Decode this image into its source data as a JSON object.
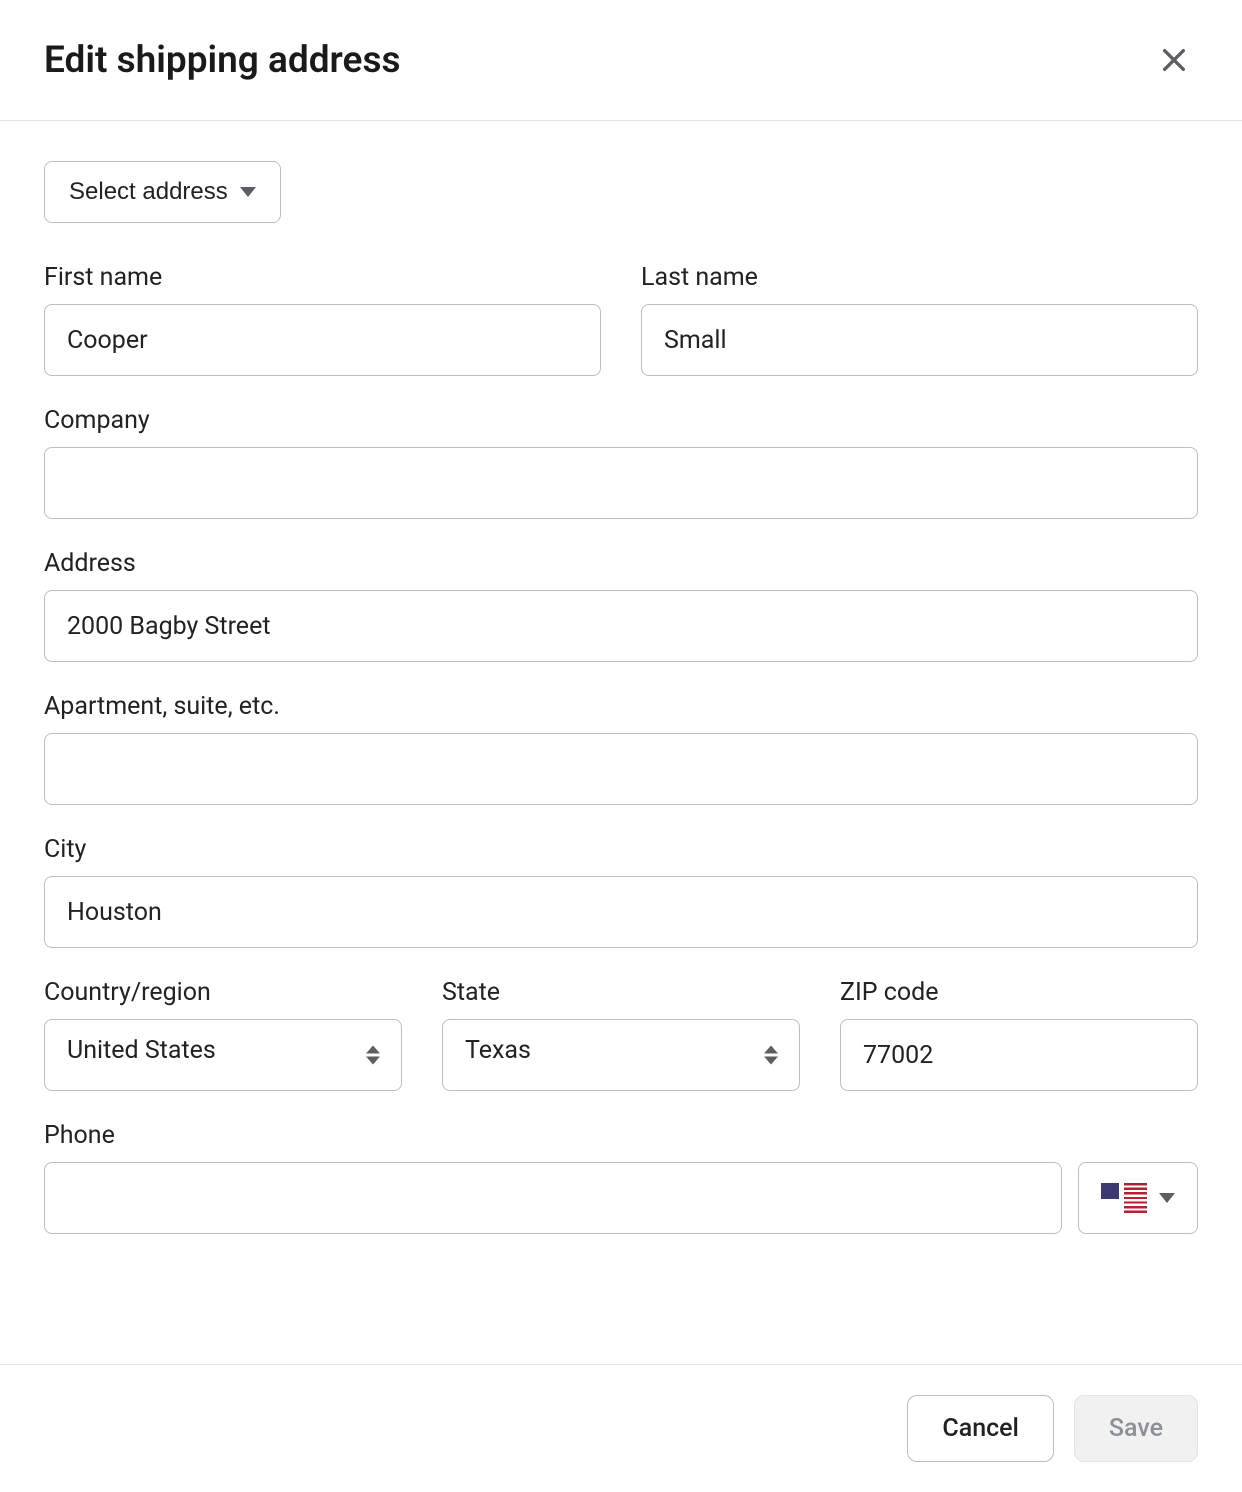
{
  "modal": {
    "title": "Edit shipping address",
    "select_address_label": "Select address"
  },
  "form": {
    "first_name": {
      "label": "First name",
      "value": "Cooper"
    },
    "last_name": {
      "label": "Last name",
      "value": "Small"
    },
    "company": {
      "label": "Company",
      "value": ""
    },
    "address": {
      "label": "Address",
      "value": "2000 Bagby Street"
    },
    "apartment": {
      "label": "Apartment, suite, etc.",
      "value": ""
    },
    "city": {
      "label": "City",
      "value": "Houston"
    },
    "country": {
      "label": "Country/region",
      "value": "United States"
    },
    "state": {
      "label": "State",
      "value": "Texas"
    },
    "zip": {
      "label": "ZIP code",
      "value": "77002"
    },
    "phone": {
      "label": "Phone",
      "value": "",
      "country_code": "US"
    }
  },
  "footer": {
    "cancel": "Cancel",
    "save": "Save"
  }
}
